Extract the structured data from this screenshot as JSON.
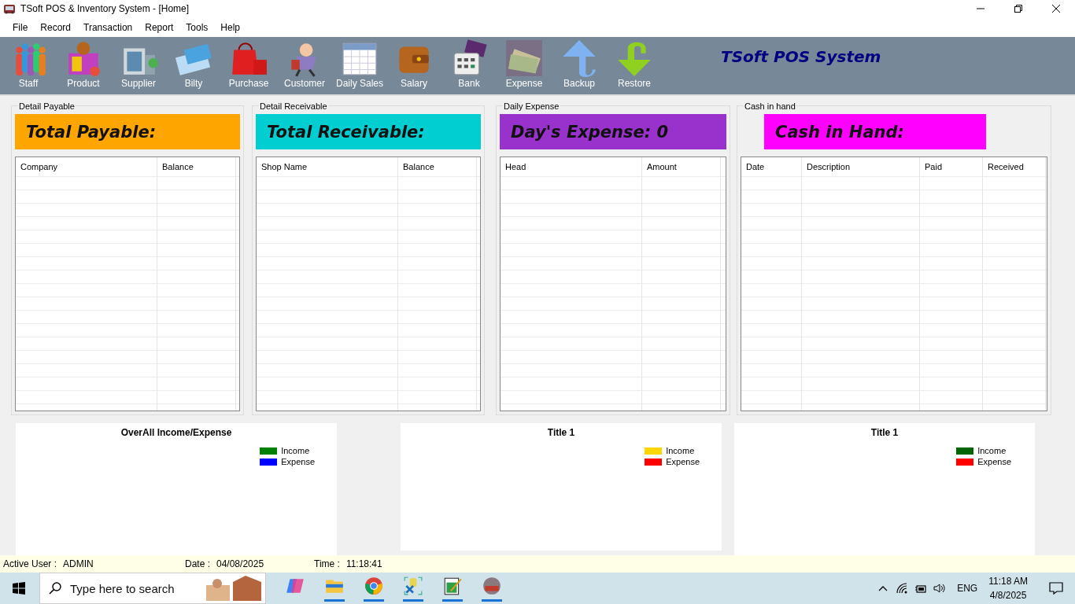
{
  "window": {
    "title": "TSoft POS & Inventory System - [Home]"
  },
  "menu": [
    "File",
    "Record",
    "Transaction",
    "Report",
    "Tools",
    "Help"
  ],
  "toolbar": {
    "items": [
      "Staff",
      "Product",
      "Supplier",
      "Bilty",
      "Purchase",
      "Customer",
      "Daily Sales",
      "Salary",
      "Bank",
      "Expense",
      "Backup",
      "Restore"
    ],
    "title": "TSoft POS System"
  },
  "panels": [
    {
      "title": "Detail Payable",
      "header": "Total Payable:",
      "color": "#ffa500",
      "columns": [
        "Company",
        "Balance"
      ]
    },
    {
      "title": "Detail Receivable",
      "header": "Total Receivable:",
      "color": "#00ced1",
      "columns": [
        "Shop Name",
        "Balance"
      ]
    },
    {
      "title": "Daily Expense",
      "header": "Day's Expense: 0",
      "color": "#9932cc",
      "columns": [
        "Head",
        "Amount"
      ]
    },
    {
      "title": "Cash in hand",
      "header": "Cash in Hand:",
      "color": "#ff00ff",
      "columns": [
        "Date",
        "Description",
        "Paid",
        "Received"
      ]
    }
  ],
  "charts": [
    {
      "title": "OverAll Income/Expense",
      "legend": [
        {
          "label": "Income",
          "color": "#008000"
        },
        {
          "label": "Expense",
          "color": "#0000ff"
        }
      ]
    },
    {
      "title": "Title 1",
      "legend": [
        {
          "label": "Income",
          "color": "#ffd700"
        },
        {
          "label": "Expense",
          "color": "#ff0000"
        }
      ]
    },
    {
      "title": "Title 1",
      "legend": [
        {
          "label": "Income",
          "color": "#006400"
        },
        {
          "label": "Expense",
          "color": "#ff0000"
        }
      ]
    }
  ],
  "status_bar": [
    {
      "label": "Active User :",
      "value": "ADMIN"
    },
    {
      "label": "Date :",
      "value": "04/08/2025"
    },
    {
      "label": "Time :",
      "value": "11:18:41"
    }
  ],
  "taskbar": {
    "search": {
      "placeholder": "Type here to search"
    },
    "language": "ENG",
    "time": "11:18 AM",
    "date": "4/8/2025"
  }
}
